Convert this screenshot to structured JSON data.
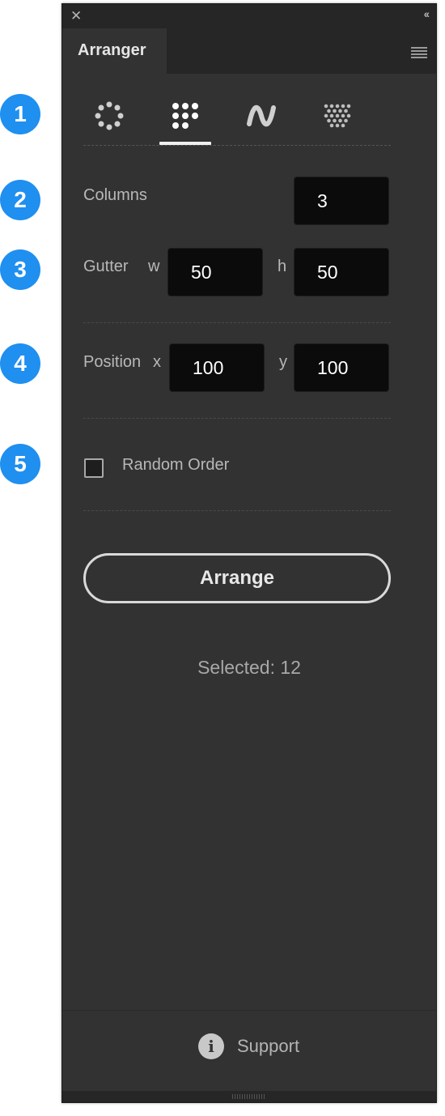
{
  "panel": {
    "title": "Arranger",
    "mode_tabs": [
      {
        "icon": "circle-arrangement-icon",
        "active": false
      },
      {
        "icon": "grid-arrangement-icon",
        "active": true
      },
      {
        "icon": "wave-arrangement-icon",
        "active": false
      },
      {
        "icon": "diamond-pattern-icon",
        "active": false
      }
    ]
  },
  "columns": {
    "label": "Columns",
    "value": "3"
  },
  "gutter": {
    "label": "Gutter",
    "w_label": "w",
    "w_value": "50",
    "h_label": "h",
    "h_value": "50"
  },
  "position": {
    "label": "Position",
    "x_label": "x",
    "x_value": "100",
    "y_label": "y",
    "y_value": "100"
  },
  "random_order": {
    "label": "Random Order",
    "checked": false
  },
  "arrange_button": "Arrange",
  "status": {
    "selected_text": "Selected: 12"
  },
  "footer": {
    "support_label": "Support",
    "info_icon_text": "i"
  },
  "callouts": [
    "1",
    "2",
    "3",
    "4",
    "5"
  ],
  "colors": {
    "panel_bg": "#323232",
    "header_bg": "#262626",
    "field_bg": "#0b0b0b",
    "callout_blue": "#1f8ff0"
  }
}
